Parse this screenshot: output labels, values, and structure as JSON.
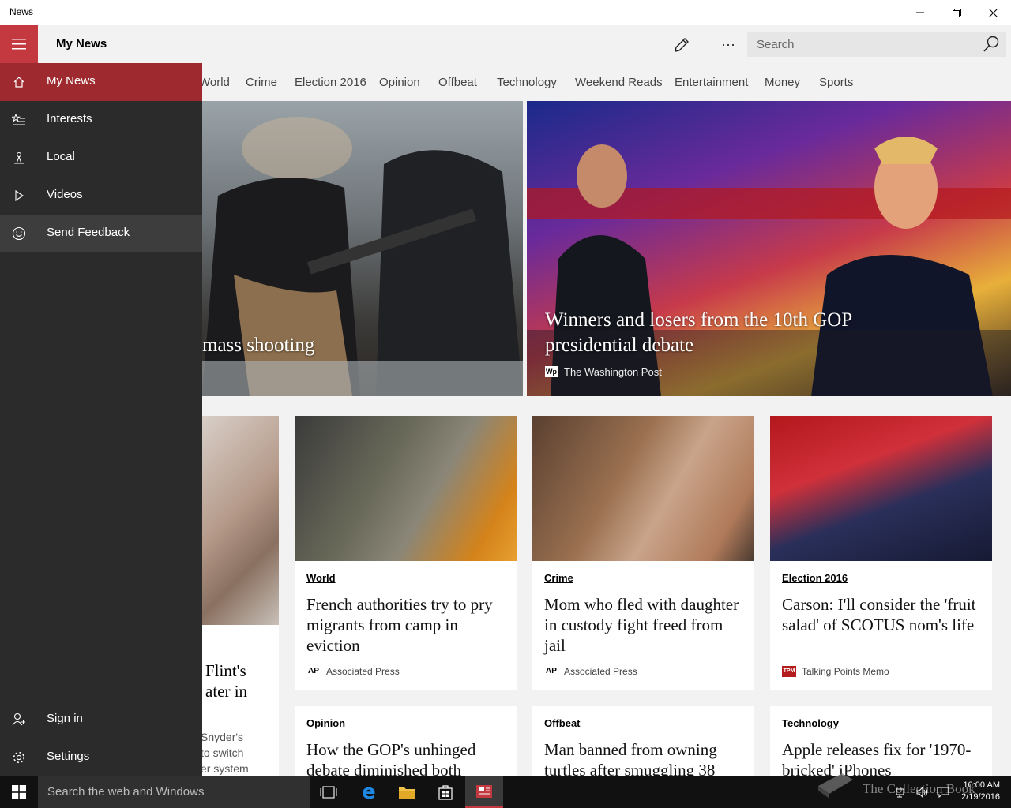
{
  "window": {
    "title": "News"
  },
  "header": {
    "title": "My News",
    "search_placeholder": "Search"
  },
  "tabs": [
    "World",
    "Crime",
    "Election 2016",
    "Opinion",
    "Offbeat",
    "Technology",
    "Weekend Reads",
    "Entertainment",
    "Money",
    "Sports"
  ],
  "nav": {
    "items": [
      {
        "label": "My News",
        "icon": "home-icon"
      },
      {
        "label": "Interests",
        "icon": "interests-icon"
      },
      {
        "label": "Local",
        "icon": "local-icon"
      },
      {
        "label": "Videos",
        "icon": "play-icon"
      },
      {
        "label": "Send Feedback",
        "icon": "smiley-icon"
      }
    ],
    "bottom": [
      {
        "label": "Sign in",
        "icon": "add-user-icon"
      },
      {
        "label": "Settings",
        "icon": "gear-icon"
      }
    ]
  },
  "hero": [
    {
      "title": "mass shooting"
    },
    {
      "title": "Winners and losers from the 10th GOP presidential debate",
      "source": "The Washington Post"
    }
  ],
  "partial_card": {
    "title_line1": "Flint's",
    "title_line2": "ater in",
    "desc_line1": "Snyder's",
    "desc_line2": "to switch",
    "desc_line3": "er system"
  },
  "cards": [
    {
      "category": "World",
      "title": "French authorities try to pry migrants from camp in eviction",
      "source": "Associated Press",
      "logo": "AP"
    },
    {
      "category": "Crime",
      "title": "Mom who fled with daughter in custody fight freed from jail",
      "source": "Associated Press",
      "logo": "AP"
    },
    {
      "category": "Election 2016",
      "title": "Carson: I'll consider the 'fruit salad' of SCOTUS nom's life",
      "source": "Talking Points Memo",
      "logo": "TPM"
    }
  ],
  "cards_row2": [
    {
      "category": "Opinion",
      "title": "How the GOP's unhinged debate diminished both"
    },
    {
      "category": "Offbeat",
      "title": "Man banned from owning turtles after smuggling 38"
    },
    {
      "category": "Technology",
      "title": "Apple releases fix for '1970-bricked' iPhones"
    }
  ],
  "taskbar": {
    "search_placeholder": "Search the web and Windows",
    "time": "10:00 AM",
    "date": "2/19/2016",
    "watermark": "The Collection Book"
  },
  "colors": {
    "accent": "#c4393f",
    "nav_bg": "#2b2b2b",
    "taskbar": "#111111"
  }
}
